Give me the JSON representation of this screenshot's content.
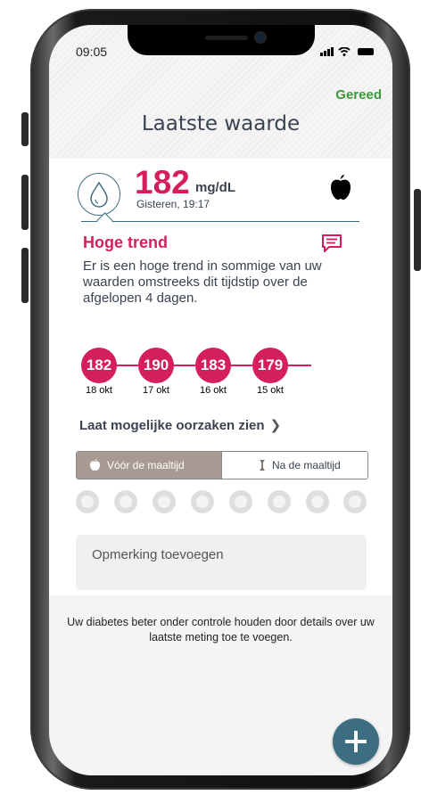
{
  "status_bar": {
    "time": "09:05"
  },
  "header": {
    "done_label": "Gereed",
    "title": "Laatste waarde"
  },
  "reading": {
    "value": "182",
    "unit": "mg/dL",
    "timestamp": "Gisteren, 19:17"
  },
  "trend": {
    "title": "Hoge trend",
    "description": "Er is een hoge trend in sommige van uw waarden omstreeks dit tijdstip over de afgelopen 4 dagen.",
    "points": [
      {
        "value": "182",
        "date": "18 okt"
      },
      {
        "value": "190",
        "date": "17 okt"
      },
      {
        "value": "183",
        "date": "16 okt"
      },
      {
        "value": "179",
        "date": "15 okt"
      }
    ]
  },
  "causes_link": "Laat mogelijke oorzaken zien",
  "meal_toggle": {
    "before": "Vóór de maaltijd",
    "after": "Na de maaltijd",
    "selected": "before"
  },
  "tag_icons": [
    "activity-icon",
    "medication-icon",
    "drink-icon",
    "sad-icon",
    "bandage-icon",
    "bottle-icon",
    "sick-icon",
    "stressed-icon"
  ],
  "note": {
    "placeholder": "Opmerking toevoegen"
  },
  "footer_text": "Uw diabetes beter onder controle houden door details over uw laatste meting toe te voegen.",
  "colors": {
    "accent": "#d41e5d",
    "primary": "#3d6d80",
    "done": "#3b9a3b"
  }
}
